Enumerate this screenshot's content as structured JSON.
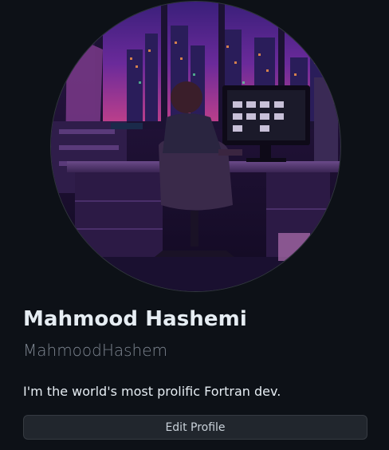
{
  "profile": {
    "avatar_alt": "Profile avatar illustration",
    "display_name": "Mahmood Hashemi",
    "username": "MahmoodHashem",
    "bio": "I'm the world's most prolific Fortran dev.",
    "edit_button_label": "Edit Profile"
  },
  "colors": {
    "background": "#0d1117",
    "text_primary": "#e6edf3",
    "text_muted": "#7d8590",
    "button_bg": "#21262d",
    "button_border": "#363b42"
  }
}
